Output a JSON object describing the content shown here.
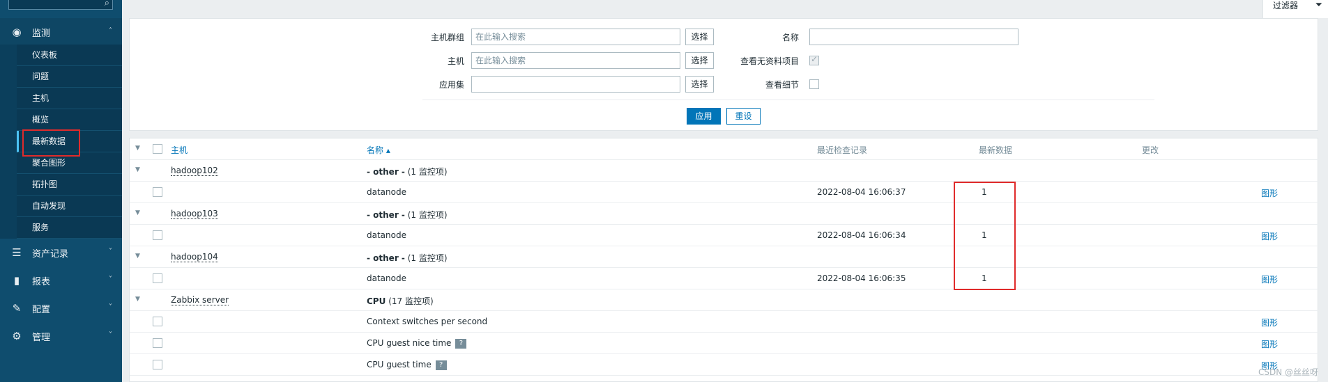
{
  "sidebar": {
    "sections": [
      {
        "name": "monitoring",
        "label": "监测",
        "icon": "eye-icon",
        "expanded": true
      },
      {
        "name": "inventory",
        "label": "资产记录",
        "icon": "list-icon"
      },
      {
        "name": "reports",
        "label": "报表",
        "icon": "bar-chart-icon"
      },
      {
        "name": "configuration",
        "label": "配置",
        "icon": "wrench-icon"
      },
      {
        "name": "administration",
        "label": "管理",
        "icon": "gear-icon"
      }
    ],
    "submenu": [
      "仪表板",
      "问题",
      "主机",
      "概览",
      "最新数据",
      "聚合图形",
      "拓扑图",
      "自动发现",
      "服务"
    ]
  },
  "topbar": {
    "filter_label": "过滤器"
  },
  "filter": {
    "host_groups_label": "主机群组",
    "host_groups_placeholder": "在此输入搜索",
    "hosts_label": "主机",
    "hosts_placeholder": "在此输入搜索",
    "application_label": "应用集",
    "application_value": "",
    "select_label": "选择",
    "name_label": "名称",
    "name_value": "",
    "show_items_without_data_label": "查看无资料项目",
    "show_details_label": "查看细节",
    "apply_label": "应用",
    "reset_label": "重设"
  },
  "table": {
    "headers": {
      "host": "主机",
      "name": "名称 ▴",
      "last_check": "最近检查记录",
      "last_value": "最新数据",
      "change": "更改"
    },
    "groups": [
      {
        "host": "hadoop102",
        "app": "- other -",
        "count": "(1 监控项)",
        "items": [
          {
            "name": "datanode",
            "last_check": "2022-08-04 16:06:37",
            "last_value": "1",
            "link": "图形"
          }
        ]
      },
      {
        "host": "hadoop103",
        "app": "- other -",
        "count": "(1 监控项)",
        "items": [
          {
            "name": "datanode",
            "last_check": "2022-08-04 16:06:34",
            "last_value": "1",
            "link": "图形"
          }
        ]
      },
      {
        "host": "hadoop104",
        "app": "- other -",
        "count": "(1 监控项)",
        "items": [
          {
            "name": "datanode",
            "last_check": "2022-08-04 16:06:35",
            "last_value": "1",
            "link": "图形"
          }
        ]
      },
      {
        "host": "Zabbix server",
        "app": "CPU",
        "count": "(17 监控项)",
        "items": [
          {
            "name": "Context switches per second",
            "last_check": "",
            "last_value": "",
            "link": "图形"
          },
          {
            "name": "CPU guest nice time",
            "last_check": "",
            "last_value": "",
            "link": "图形"
          },
          {
            "name": "CPU guest time",
            "last_check": "",
            "last_value": "",
            "link": "图形"
          }
        ]
      }
    ]
  },
  "help_icon_glyph": "?",
  "watermark": "CSDN @丝丝呀",
  "colors": {
    "sidebar": "#0f4d6e",
    "link": "#0275b8",
    "highlight": "#e02b2b"
  }
}
